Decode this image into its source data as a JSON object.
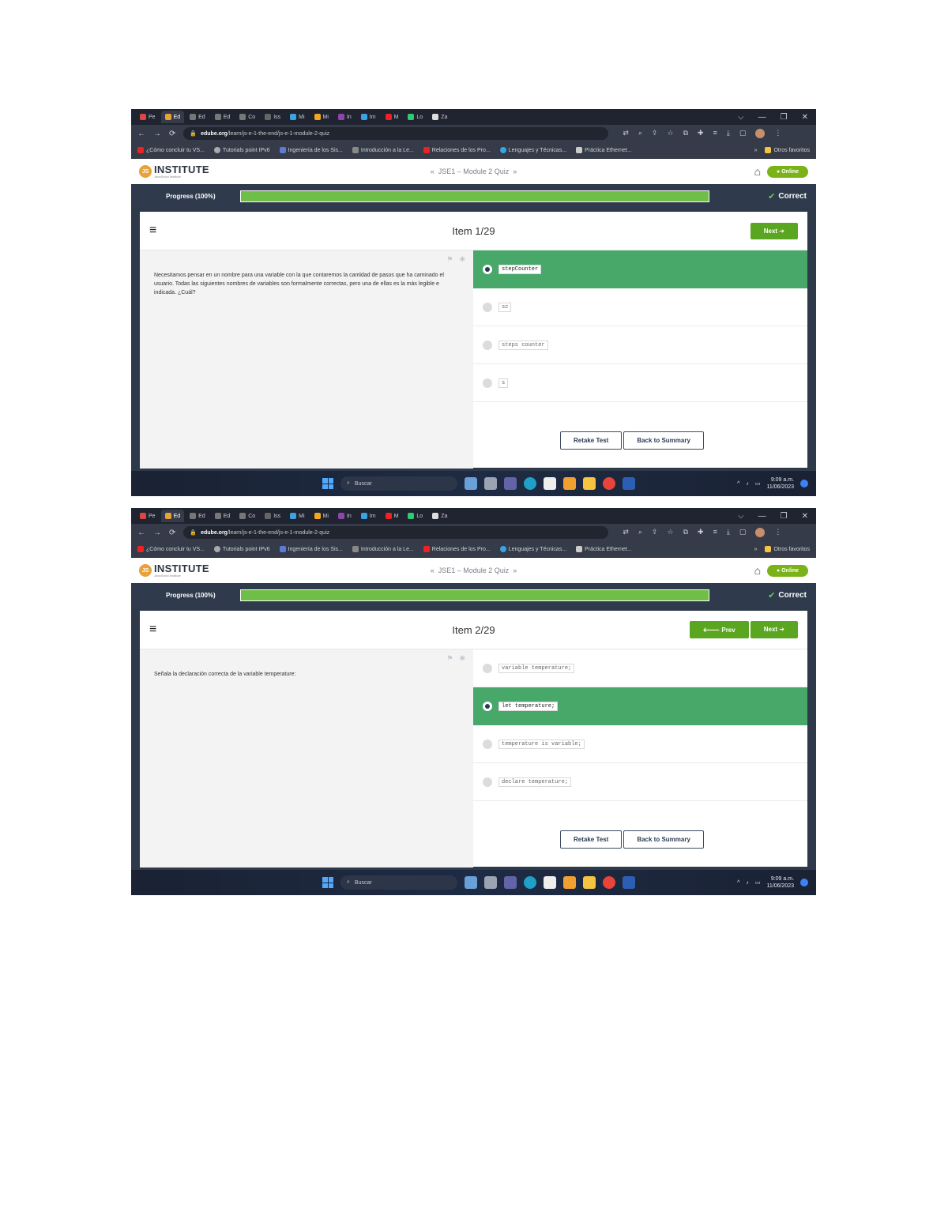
{
  "browser": {
    "tabs": [
      "Pe",
      "Ed",
      "Ed",
      "Ed",
      "Co",
      "Iss",
      "Mi",
      "Mi",
      "In",
      "Im",
      "M",
      "Lo",
      "Za"
    ],
    "window_controls": [
      "–",
      "⌵",
      "—",
      "❐",
      "✕"
    ],
    "url_host": "edube.org",
    "url_path": "/learn/js-e-1-the-end/js-e-1-module-2-quiz",
    "bookmarks": [
      "¿Cómo concluir tu VS...",
      "Tutorials point IPv6",
      "Ingeniería de los Sis...",
      "Introducción a la Le...",
      "Relaciones de los Pro...",
      "Lenguajes y Técnicas...",
      "Práctica Ethernet..."
    ],
    "other_favorites": "Otros favoritos"
  },
  "app": {
    "logo_text": "INSTITUTE",
    "logo_badge": "JS",
    "logo_sub": "JavaScript Institute",
    "breadcrumb": "JSE1 – Module 2 Quiz",
    "crumb_prev": "«",
    "crumb_next": "»",
    "online_label": "Online",
    "progress_label": "Progress (100%)",
    "progress_fraction": 1.0,
    "status": "Correct",
    "retake_label": "Retake Test",
    "summary_label": "Back to Summary",
    "next_label": "Next",
    "prev_label": "Prev"
  },
  "screens": [
    {
      "item": "Item 1/29",
      "show_prev": false,
      "question": "Necesitamos pensar en un nombre para una variable con la que contaremos la cantidad de pasos que ha caminado el usuario. Todas las siguientes nombres de variables son formalmente correctas, pero una de ellas es la más legible e indicada. ¿Cuál?",
      "answers": [
        "stepCounter",
        "sc",
        "steps counter",
        "s"
      ],
      "selected": 0
    },
    {
      "item": "Item 2/29",
      "show_prev": true,
      "question": "Señala la declaración correcta de la variable temperature:",
      "answers": [
        "variable temperature;",
        "let temperature;",
        "temperature is variable;",
        "declare temperature;"
      ],
      "selected": 1
    }
  ],
  "taskbar": {
    "search": "Buscar",
    "time": "9:09 a.m.",
    "date": "11/06/2023"
  }
}
